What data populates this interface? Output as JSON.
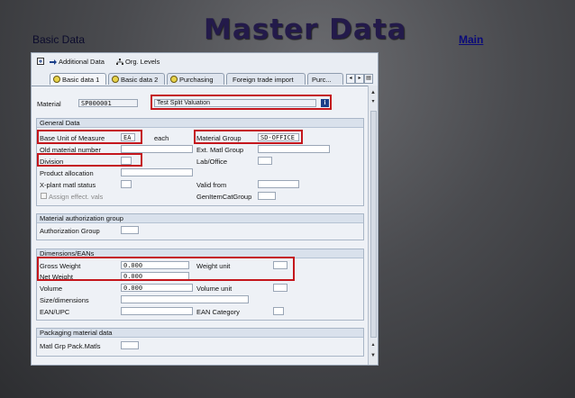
{
  "slide": {
    "left_label": "Basic Data",
    "title": "Master Data",
    "link": "Main"
  },
  "toolbar": {
    "additional_data": "Additional Data",
    "org_levels": "Org. Levels"
  },
  "tabs": [
    {
      "label": "Basic data 1",
      "active": true
    },
    {
      "label": "Basic data 2"
    },
    {
      "label": "Purchasing"
    },
    {
      "label": "Foreign trade import"
    },
    {
      "label": "Purc..."
    }
  ],
  "header": {
    "material_label": "Material",
    "material_value": "SP000001",
    "description": "Test Split Valuation"
  },
  "general": {
    "title": "General Data",
    "base_uom_label": "Base Unit of Measure",
    "base_uom_value": "EA",
    "base_uom_text": "each",
    "old_material_label": "Old material number",
    "division_label": "Division",
    "product_allocation_label": "Product allocation",
    "xplant_status_label": "X-plant matl status",
    "assign_effect_label": "Assign effect. vals",
    "material_group_label": "Material Group",
    "material_group_value": "SD-OFFICE",
    "ext_matl_group_label": "Ext. Matl Group",
    "lab_office_label": "Lab/Office",
    "valid_from_label": "Valid from",
    "gen_item_cat_label": "GenItemCatGroup"
  },
  "auth": {
    "title": "Material authorization group",
    "auth_group_label": "Authorization Group"
  },
  "dims": {
    "title": "Dimensions/EANs",
    "gross_weight_label": "Gross Weight",
    "gross_weight_value": "0.000",
    "net_weight_label": "Net Weight",
    "net_weight_value": "0.000",
    "volume_label": "Volume",
    "volume_value": "0.000",
    "size_label": "Size/dimensions",
    "ean_label": "EAN/UPC",
    "weight_unit_label": "Weight unit",
    "volume_unit_label": "Volume unit",
    "ean_category_label": "EAN Category"
  },
  "packaging": {
    "title": "Packaging material data",
    "matl_grp_pack_label": "Matl Grp Pack.Matls"
  }
}
